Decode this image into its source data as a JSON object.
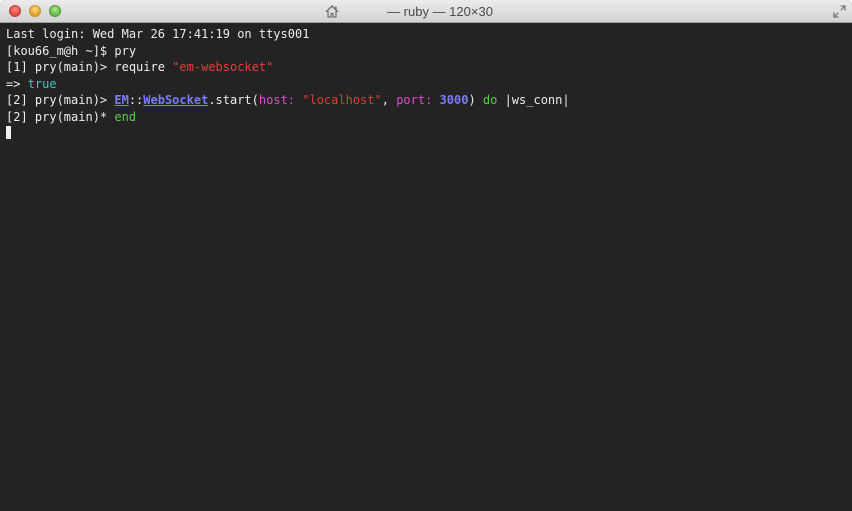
{
  "window": {
    "title": "— ruby — 120×30",
    "icons": {
      "home": "home-icon",
      "fullscreen": "fullscreen-icon"
    }
  },
  "terminal": {
    "login_line": "Last login: Wed Mar 26 17:41:19 on ttys001",
    "shell_prompt": "[kou66_m@h ~]$ ",
    "shell_command": "pry",
    "line1": {
      "prompt": "[1] pry(main)> ",
      "cmd": "require ",
      "arg": "\"em-websocket\""
    },
    "result": {
      "arrow": "=> ",
      "value": "true"
    },
    "line2": {
      "prompt": "[2] pry(main)> ",
      "const1": "EM",
      "sep": "::",
      "const2": "WebSocket",
      "method": ".start(",
      "key1": "host:",
      "space1": " ",
      "val1": "\"localhost\"",
      "comma": ", ",
      "key2": "port:",
      "space2": " ",
      "val2": "3000",
      "close": ") ",
      "do": "do",
      "block": " |ws_conn|"
    },
    "line3": {
      "prompt": "[2] pry(main)* ",
      "end": "end"
    }
  },
  "colors": {
    "background": "#232323",
    "text": "#ececec",
    "string": "#e0403a",
    "boolean": "#3fc6c2",
    "constant": "#7b7bff",
    "symbol": "#d64fd0",
    "keyword": "#5cc84a"
  }
}
